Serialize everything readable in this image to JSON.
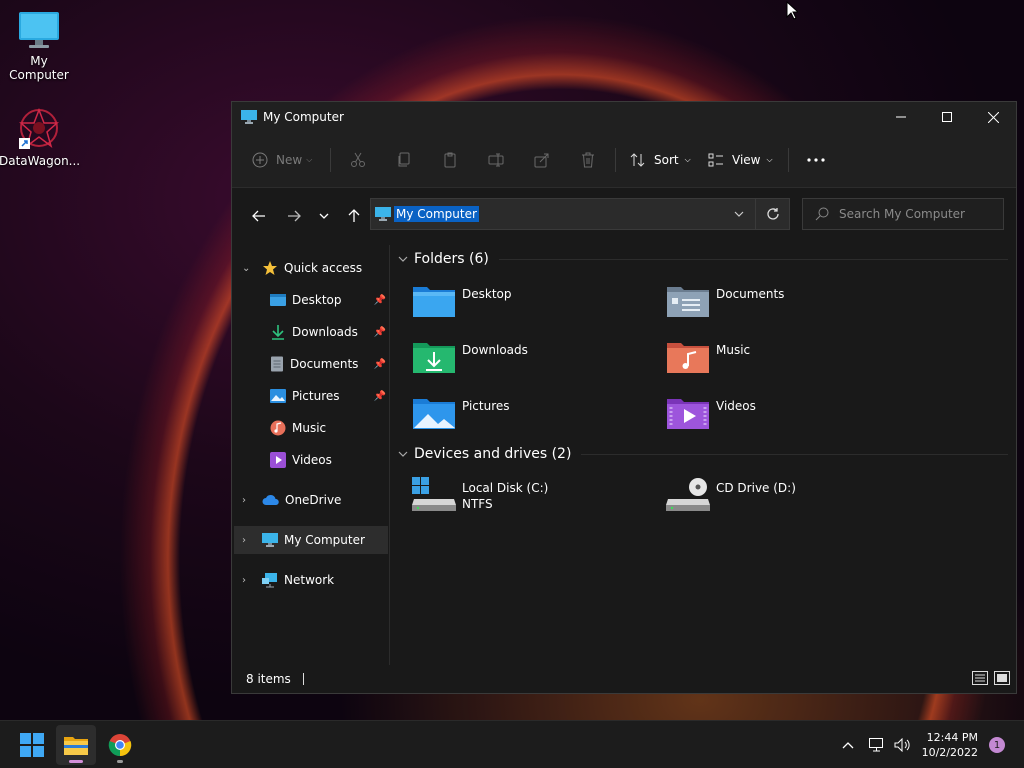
{
  "desktop": {
    "icons": [
      {
        "label": "My Computer",
        "icon": "monitor-icon"
      },
      {
        "label": "DataWagon...",
        "icon": "app-shortcut-icon"
      }
    ]
  },
  "window": {
    "title": "My Computer",
    "controls": {
      "minimize": "minimize-icon",
      "maximize": "maximize-icon",
      "close": "close-icon"
    }
  },
  "cmdbar": {
    "new_label": "New",
    "sort_label": "Sort",
    "view_label": "View",
    "disabled_actions": [
      "cut",
      "copy",
      "paste",
      "rename",
      "share",
      "delete"
    ]
  },
  "address": {
    "path": "My Computer",
    "search_placeholder": "Search My Computer"
  },
  "sidebar": {
    "quick_access": "Quick access",
    "items": [
      {
        "label": "Desktop",
        "pinned": true
      },
      {
        "label": "Downloads",
        "pinned": true
      },
      {
        "label": "Documents",
        "pinned": true
      },
      {
        "label": "Pictures",
        "pinned": true
      },
      {
        "label": "Music",
        "pinned": false
      },
      {
        "label": "Videos",
        "pinned": false
      }
    ],
    "onedrive": "OneDrive",
    "my_computer": "My Computer",
    "network": "Network"
  },
  "content": {
    "folders_header": "Folders (6)",
    "folders": [
      {
        "label": "Desktop"
      },
      {
        "label": "Documents"
      },
      {
        "label": "Downloads"
      },
      {
        "label": "Music"
      },
      {
        "label": "Pictures"
      },
      {
        "label": "Videos"
      }
    ],
    "drives_header": "Devices and drives (2)",
    "drives": [
      {
        "label": "Local Disk (C:)",
        "sub": "NTFS"
      },
      {
        "label": "CD Drive (D:)",
        "sub": ""
      }
    ]
  },
  "status": {
    "items_text": "8 items"
  },
  "taskbar": {
    "time": "12:44 PM",
    "date": "10/2/2022",
    "notifications": "1"
  },
  "colors": {
    "accent": "#0a62c4",
    "selection": "#2d2d2d",
    "window_bg": "#191919"
  }
}
